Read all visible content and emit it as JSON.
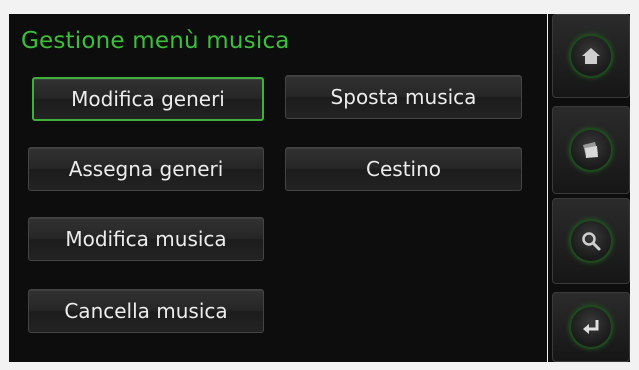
{
  "title": "Gestione menù musica",
  "buttons": {
    "modifica_generi": "Modifica generi",
    "assegna_generi": "Assegna generi",
    "modifica_musica": "Modifica musica",
    "cancella_musica": "Cancella musica",
    "sposta_musica": "Sposta musica",
    "cestino": "Cestino"
  },
  "selected_button": "modifica_generi",
  "sidebar": {
    "icons": [
      "home-icon",
      "cards-icon",
      "search-icon",
      "back-icon"
    ]
  },
  "colors": {
    "accent": "#3cbf3a",
    "background": "#0d0d0d",
    "button_text": "#ececec"
  }
}
